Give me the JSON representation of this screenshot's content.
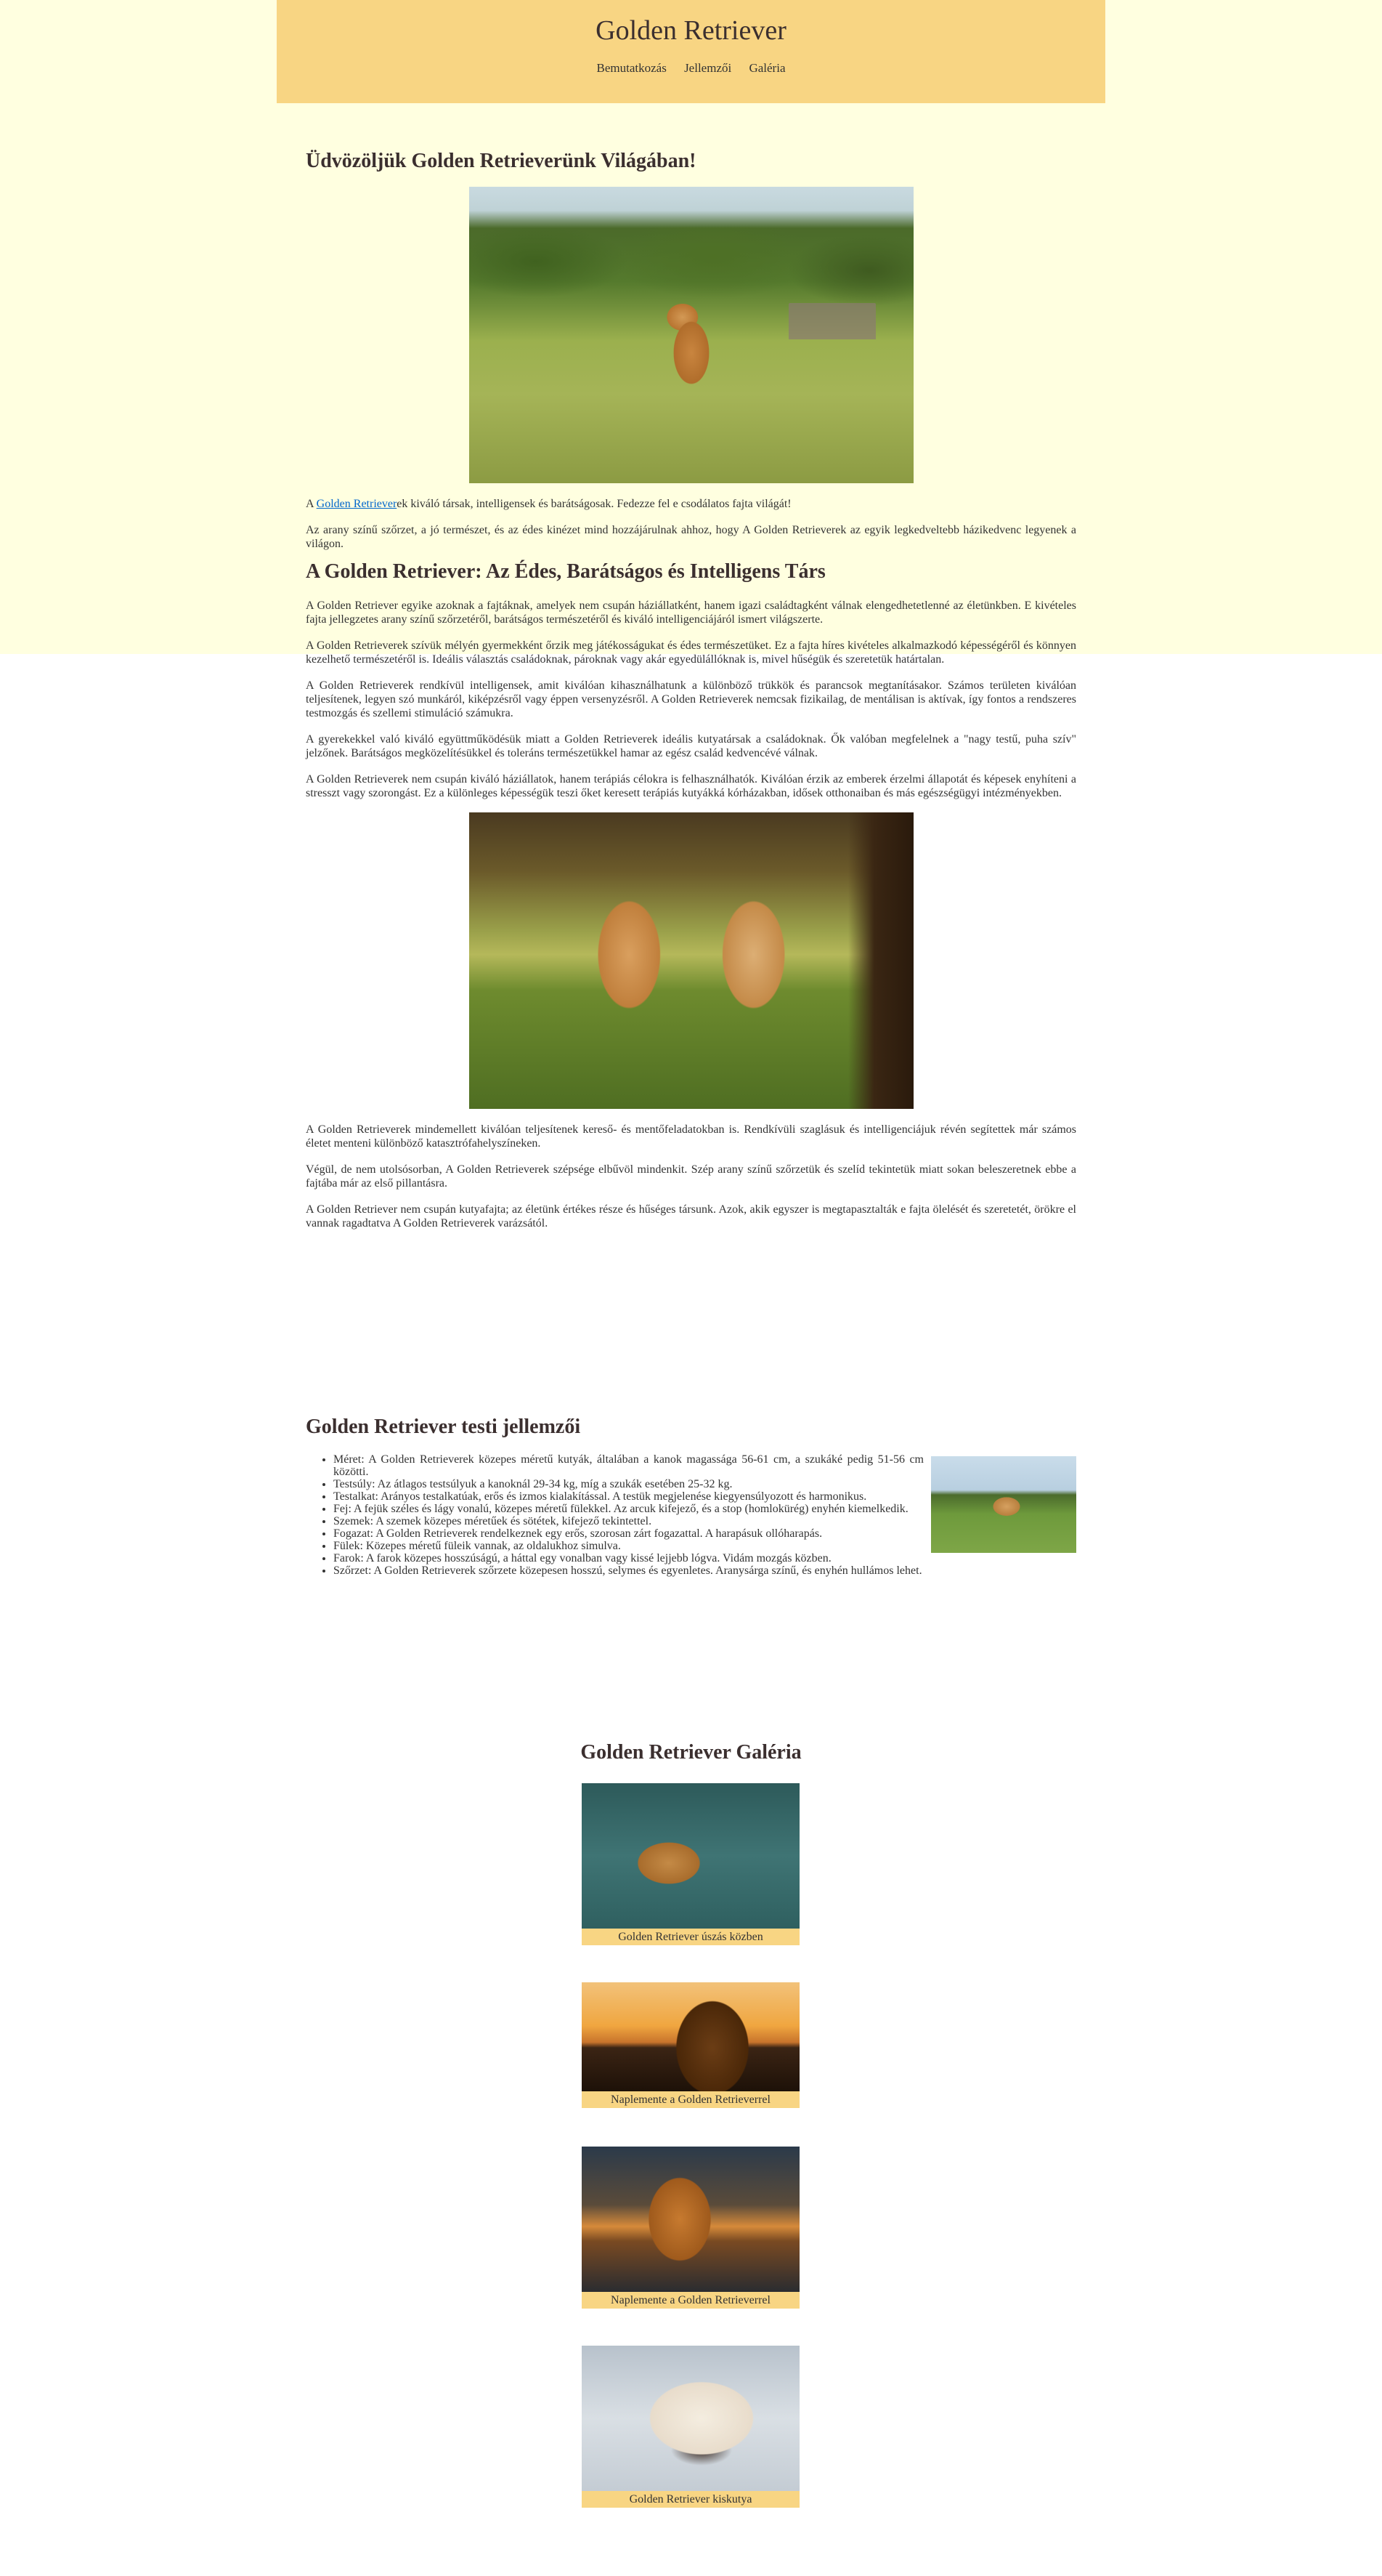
{
  "site": {
    "title": "Golden Retriever",
    "nav": [
      "Bemutatkozás",
      "Jellemzői",
      "Galéria"
    ]
  },
  "intro": {
    "heading": "Üdvözöljük Golden Retrieverünk Világában!",
    "p1_before_link": "A ",
    "p1_link": "Golden Retriever",
    "p1_after_link": "ek kiváló társak, intelligensek és barátságosak. Fedezze fel e csodálatos fajta világát!",
    "p2": "Az arany színű szőrzet, a jó természet, és az édes kinézet mind hozzájárulnak ahhoz, hogy A Golden Retrieverek az egyik legkedveltebb házikedvenc legyenek a világon."
  },
  "about": {
    "heading": "A Golden Retriever: Az Édes, Barátságos és Intelligens Társ",
    "paragraphs": [
      "A Golden Retriever egyike azoknak a fajtáknak, amelyek nem csupán háziállatként, hanem igazi családtagként válnak elengedhetetlenné az életünkben. E kivételes fajta jellegzetes arany színű szőrzetéről, barátságos természetéről és kiváló intelligenciájáról ismert világszerte.",
      "A Golden Retrieverek szívük mélyén gyermekként őrzik meg játékosságukat és édes természetüket. Ez a fajta híres kivételes alkalmazkodó képességéről és könnyen kezelhető természetéről is. Ideális választás családoknak, pároknak vagy akár egyedülállóknak is, mivel hűségük és szeretetük határtalan.",
      "A Golden Retrieverek rendkívül intelligensek, amit kiválóan kihasználhatunk a különböző trükkök és parancsok megtanításakor. Számos területen kiválóan teljesítenek, legyen szó munkáról, kiképzésről vagy éppen versenyzésről. A Golden Retrieverek nemcsak fizikailag, de mentálisan is aktívak, így fontos a rendszeres testmozgás és szellemi stimuláció számukra.",
      "A gyerekekkel való kiváló együttműködésük miatt a Golden Retrieverek ideális kutyatársak a családoknak. Ők valóban megfelelnek a \"nagy testű, puha szív\" jelzőnek. Barátságos megközelítésükkel és toleráns természetükkel hamar az egész család kedvencévé válnak.",
      "A Golden Retrieverek nem csupán kiváló háziállatok, hanem terápiás célokra is felhasználhatók. Kiválóan érzik az emberek érzelmi állapotát és képesek enyhíteni a stresszt vagy szorongást. Ez a különleges képességük teszi őket keresett terápiás kutyákká kórházakban, idősek otthonaiban és más egészségügyi intézményekben."
    ],
    "paragraphs_after": [
      "A Golden Retrieverek mindemellett kiválóan teljesítenek kereső- és mentőfeladatokban is. Rendkívüli szaglásuk és intelligenciájuk révén segítettek már számos életet menteni különböző katasztrófahelyszíneken.",
      "Végül, de nem utolsósorban, A Golden Retrieverek szépsége elbűvöl mindenkit. Szép arany színű szőrzetük és szelíd tekintetük miatt sokan beleszeretnek ebbe a fajtába már az első pillantásra.",
      "A Golden Retriever nem csupán kutyafajta; az életünk értékes része és hűséges társunk. Azok, akik egyszer is megtapasztalták e fajta ölelését és szeretetét, örökre el vannak ragadtatva A Golden Retrieverek varázsától."
    ]
  },
  "traits": {
    "heading": "Golden Retriever testi jellemzői",
    "items": [
      "Méret: A Golden Retrieverek közepes méretű kutyák, általában a kanok magassága 56-61 cm, a szukáké pedig 51-56 cm közötti.",
      "Testsúly: Az átlagos testsúlyuk a kanoknál 29-34 kg, míg a szukák esetében 25-32 kg.",
      "Testalkat: Arányos testalkatúak, erős és izmos kialakítással. A testük megjelenése kiegyensúlyozott és harmonikus.",
      "Fej: A fejük széles és lágy vonalú, közepes méretű fülekkel. Az arcuk kifejező, és a stop (homlokürég) enyhén kiemelkedik.",
      "Szemek: A szemek közepes méretűek és sötétek, kifejező tekintettel.",
      "Fogazat: A Golden Retrieverek rendelkeznek egy erős, szorosan zárt fogazattal. A harapásuk ollóharapás.",
      "Fülek: Közepes méretű füleik vannak, az oldalukhoz simulva.",
      "Farok: A farok közepes hosszúságú, a háttal egy vonalban vagy kissé lejjebb lógva. Vidám mozgás közben.",
      "Szőrzet: A Golden Retrieverek szőrzete közepesen hosszú, selymes és egyenletes. Aranysárga színű, és enyhén hullámos lehet."
    ]
  },
  "gallery": {
    "heading": "Golden Retriever Galéria",
    "captions": [
      "Golden Retriever úszás közben",
      "Naplemente a Golden Retrieverrel",
      "Naplemente a Golden Retrieverrel",
      "Golden Retriever kiskutya"
    ]
  },
  "colors": {
    "header_bg": "#f8d583",
    "page_bg": "#ffffe0",
    "heading": "#3b2f2f",
    "link": "#0066cc"
  }
}
